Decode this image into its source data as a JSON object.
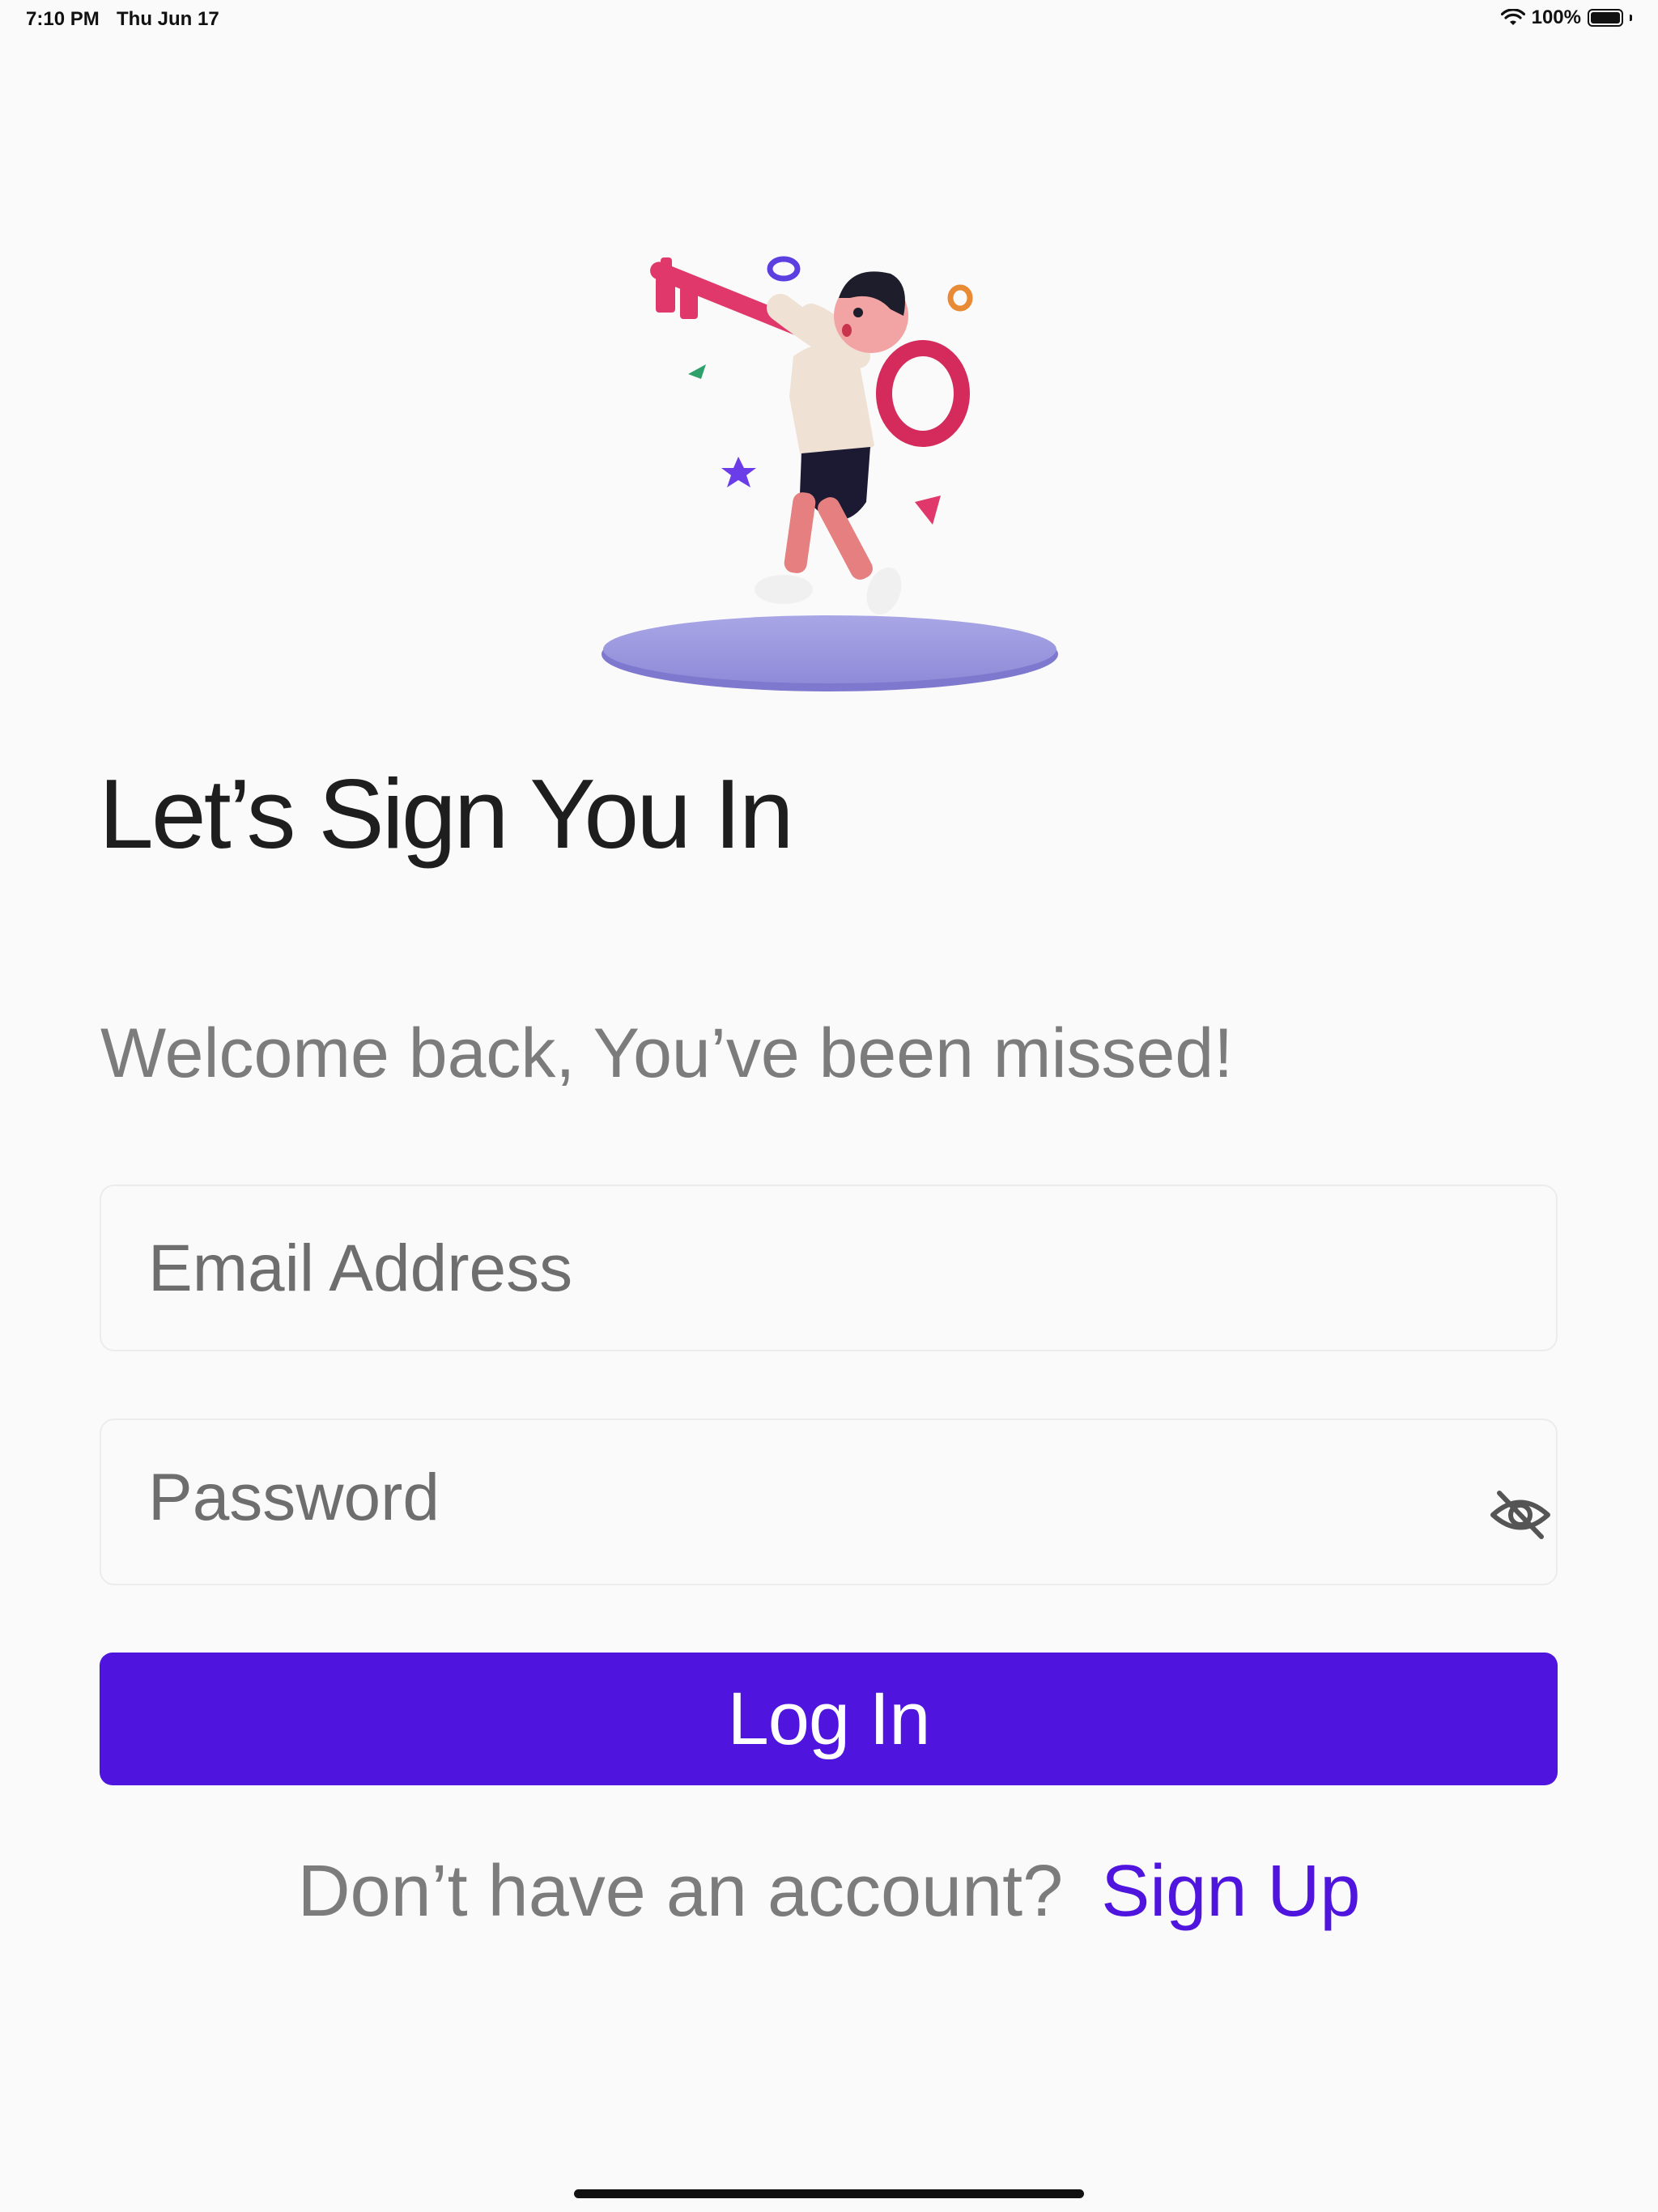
{
  "status_bar": {
    "time": "7:10 PM",
    "date": "Thu Jun 17",
    "battery": "100%",
    "battery_level": 1.0
  },
  "illustration": {
    "icon": "key-person-illustration"
  },
  "header": {
    "title": "Let’s Sign You In",
    "subtitle": "Welcome back, You’ve been missed!"
  },
  "form": {
    "email_placeholder": "Email Address",
    "email_value": "",
    "password_placeholder": "Password",
    "password_value": "",
    "password_toggle_icon": "eye-off-icon"
  },
  "login_button": {
    "label": "Log In"
  },
  "signup": {
    "prompt": "Don’t have an account?",
    "link": "Sign Up"
  },
  "colors": {
    "accent": "#4f14dd",
    "title": "#1e1e1e",
    "muted": "#7c7c7c",
    "background": "#fafafa",
    "field_border": "#ececec"
  }
}
